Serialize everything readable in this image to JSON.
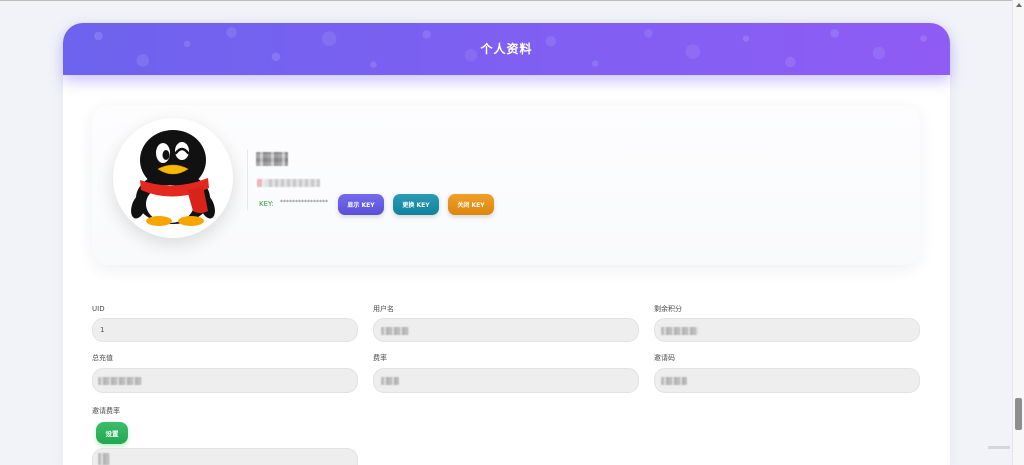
{
  "header": {
    "title": "个人资料"
  },
  "profile": {
    "avatar_icon": "qq-penguin-icon",
    "key_label": "KEY:",
    "key_masked": "****************",
    "buttons": [
      {
        "label": "显示 KEY",
        "color": "#6157ea"
      },
      {
        "label": "更换 KEY",
        "color": "#0f8eab"
      },
      {
        "label": "关闭 KEY",
        "color": "#ee920d"
      }
    ]
  },
  "fields": [
    {
      "label": "UID",
      "value": "1"
    },
    {
      "label": "用户名"
    },
    {
      "label": "剩余积分"
    },
    {
      "label": "总充值"
    },
    {
      "label": "费率"
    },
    {
      "label": "邀请码"
    }
  ],
  "invite_rate": {
    "label": "邀请费率",
    "button_label": "设置",
    "button_color": "#22b455"
  },
  "colors": {
    "header_start": "#6d63ee",
    "header_end": "#8f5cf5",
    "key_label": "#2e9e3e",
    "page_background": "#f1f3f9"
  }
}
